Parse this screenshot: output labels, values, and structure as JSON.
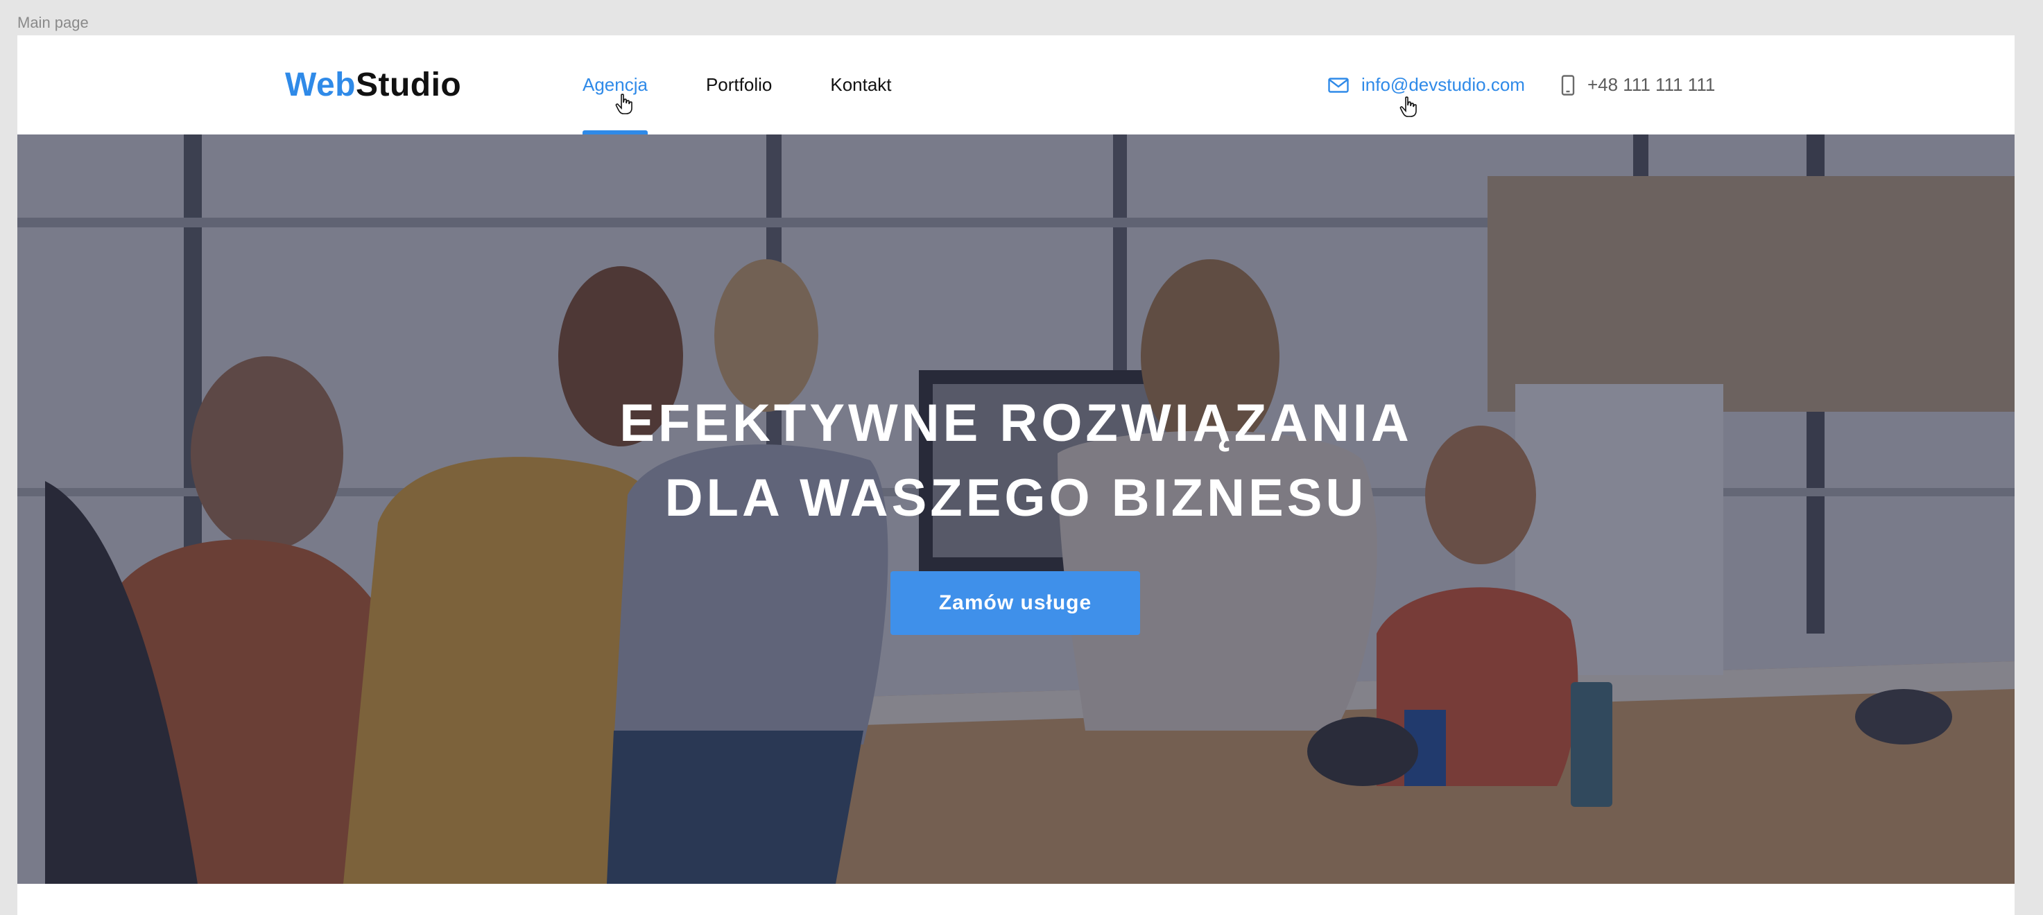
{
  "frame": {
    "label": "Main page"
  },
  "header": {
    "logo": {
      "part1": "Web",
      "part2": "Studio"
    },
    "nav": [
      {
        "label": "Agencja",
        "active": true
      },
      {
        "label": "Portfolio",
        "active": false
      },
      {
        "label": "Kontakt",
        "active": false
      }
    ],
    "contacts": {
      "email": {
        "text": "info@devstudio.com",
        "icon": "mail-icon"
      },
      "phone": {
        "text": "+48 111 111 111",
        "icon": "smartphone-icon"
      }
    }
  },
  "hero": {
    "title_line1": "EFEKTYWNE ROZWIĄZANIA",
    "title_line2": "DLA WASZEGO BIZNESU",
    "cta_label": "Zamów usługe",
    "image": "office-team-photo"
  },
  "colors": {
    "accent": "#2f8ae8",
    "button": "#3f90ea",
    "text": "#111111",
    "muted": "#5c5c5c",
    "frame_bg": "#e5e5e5"
  }
}
